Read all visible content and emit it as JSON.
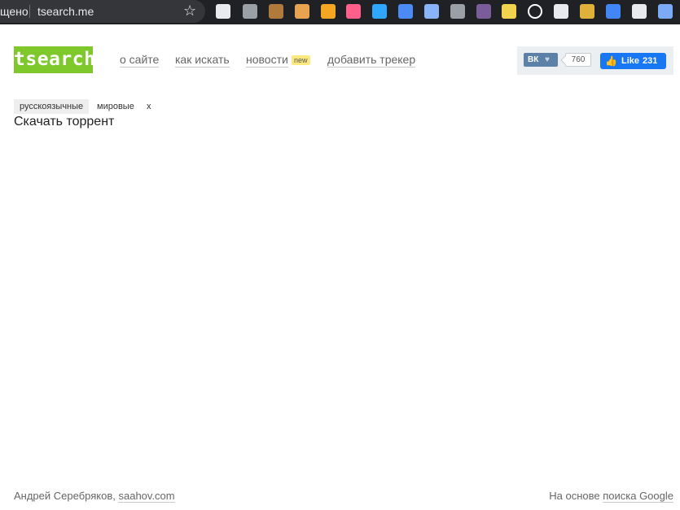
{
  "browser": {
    "omnibox_prefix": "щено",
    "url": "tsearch.me",
    "star_icon": "star-icon",
    "extensions": [
      {
        "name": "document-icon",
        "color": "#e8eaed"
      },
      {
        "name": "edge-e-icon",
        "color": "#9aa0a6"
      },
      {
        "name": "poop-icon",
        "color": "#b07a3c"
      },
      {
        "name": "face-icon",
        "color": "#e7a34f"
      },
      {
        "name": "shield-orange-icon",
        "color": "#f6a623"
      },
      {
        "name": "dots-icon",
        "color": "#ff5f8a"
      },
      {
        "name": "camera-icon",
        "color": "#2fa7ff"
      },
      {
        "name": "screen-icon",
        "color": "#4c8bf5"
      },
      {
        "name": "photo-icon",
        "color": "#8ab4f8"
      },
      {
        "name": "cloud-icon",
        "color": "#9aa0a6"
      },
      {
        "name": "mask-icon",
        "color": "#7a5c9a"
      },
      {
        "name": "note-icon",
        "color": "#f2d34d"
      },
      {
        "name": "circle-icon",
        "color": "#ffffff"
      },
      {
        "name": "scissors-icon",
        "color": "#e8eaed"
      },
      {
        "name": "wallet-icon",
        "color": "#e0b13a"
      },
      {
        "name": "translate-icon",
        "color": "#4285f4"
      },
      {
        "name": "skull-icon",
        "color": "#e8eaed"
      },
      {
        "name": "diamond-icon",
        "color": "#7baaf7"
      }
    ]
  },
  "header": {
    "logo": "tsearch",
    "nav": [
      {
        "label": "о сайте"
      },
      {
        "label": "как искать"
      },
      {
        "label": "новости"
      },
      {
        "label": "добавить трекер"
      }
    ],
    "news_badge": "new"
  },
  "social": {
    "vk_logo": "ВК",
    "vk_heart": "♥",
    "vk_count": "760",
    "fb_thumb": "👍",
    "fb_label": "Like",
    "fb_count": "231"
  },
  "filters": {
    "items": [
      {
        "label": "русскоязычные",
        "active": true
      },
      {
        "label": "мировые",
        "active": false
      },
      {
        "label": "x",
        "active": false
      }
    ]
  },
  "results": {
    "title": "Скачать торрент"
  },
  "footer": {
    "author": "Андрей Серебряков,",
    "author_link": "saahov.com",
    "powered_prefix": "На основе",
    "powered_link": "поиска Google"
  },
  "colors": {
    "logo_bg": "#7ec82b",
    "vk": "#5b81a8",
    "fb": "#1877f2",
    "badge": "#fbe97f"
  }
}
